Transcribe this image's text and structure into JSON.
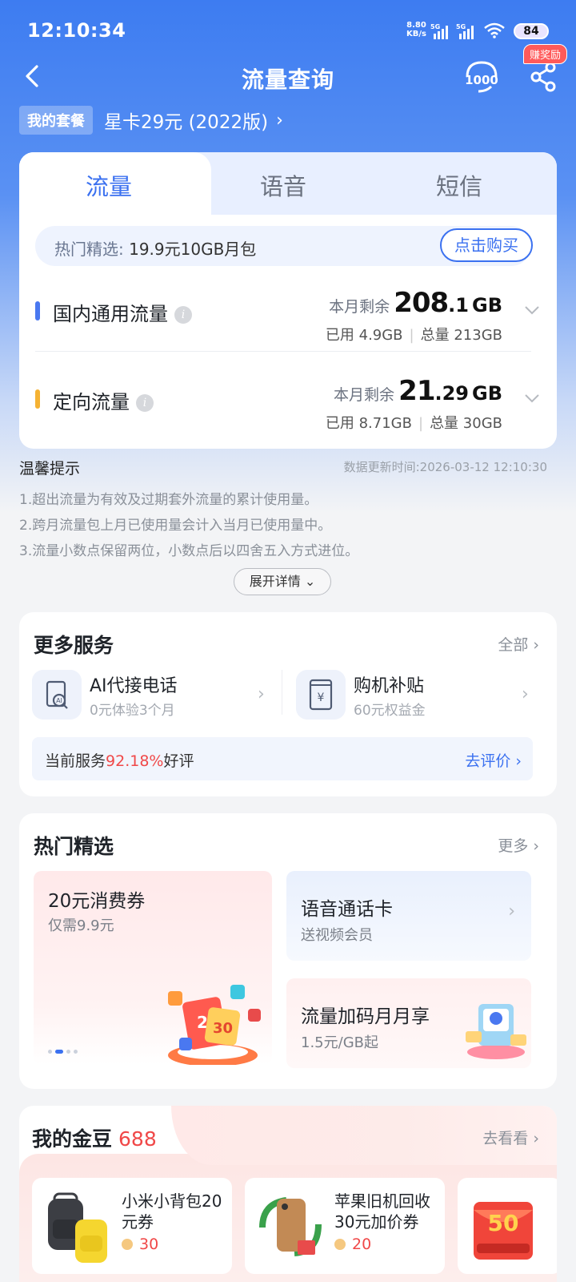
{
  "status": {
    "time": "12:10:34",
    "speed_value": "8.80",
    "speed_unit": "KB/s",
    "sim1": "5G",
    "sim2": "5G",
    "battery": "84"
  },
  "header": {
    "title": "流量查询",
    "service_icon": "service-1000-icon",
    "share_icon": "share-icon",
    "reward_badge": "赚奖励"
  },
  "plan": {
    "tag": "我的套餐",
    "name": "星卡29元 (2022版)"
  },
  "tabs": [
    {
      "label": "流量",
      "active": true
    },
    {
      "label": "语音",
      "active": false
    },
    {
      "label": "短信",
      "active": false
    }
  ],
  "promo": {
    "label": "热门精选: ",
    "text": "19.9元10GB月包",
    "button": "点击购买"
  },
  "usage": [
    {
      "name": "国内通用流量",
      "bar_color": "#4a78f0",
      "remain_label": "本月剩余",
      "remain_int": "208",
      "remain_dec": ".1",
      "unit": "GB",
      "used": "已用 4.9GB",
      "total": "总量 213GB"
    },
    {
      "name": "定向流量",
      "bar_color": "#f5b233",
      "remain_label": "本月剩余",
      "remain_int": "21",
      "remain_dec": ".29",
      "unit": "GB",
      "used": "已用 8.71GB",
      "total": "总量 30GB"
    }
  ],
  "tips": {
    "title": "温馨提示",
    "update_time": "数据更新时间:2026-03-12 12:10:30",
    "items": [
      "1.超出流量为有效及过期套外流量的累计使用量。",
      "2.跨月流量包上月已使用量会计入当月已使用量中。",
      "3.流量小数点保留两位，小数点后以四舍五入方式进位。"
    ],
    "expand": "展开详情"
  },
  "services": {
    "title": "更多服务",
    "more": "全部",
    "items": [
      {
        "name": "AI代接电话",
        "sub": "0元体验3个月",
        "icon": "ai-phone-icon"
      },
      {
        "name": "购机补贴",
        "sub": "60元权益金",
        "icon": "phone-yuan-icon"
      }
    ],
    "rating_prefix": "当前服务",
    "rating_pct": "92.18%",
    "rating_suffix": "好评",
    "rate_action": "去评价"
  },
  "hot": {
    "title": "热门精选",
    "more": "更多",
    "big": {
      "name": "20元消费券",
      "sub": "仅需9.9元"
    },
    "items": [
      {
        "name": "语音通话卡",
        "sub": "送视频会员"
      },
      {
        "name": "流量加码月月享",
        "sub": "1.5元/GB起"
      }
    ]
  },
  "gold": {
    "title": "我的金豆",
    "count": "688",
    "more": "去看看",
    "products": [
      {
        "name": "小米小背包20元券",
        "price": "30"
      },
      {
        "name": "苹果旧机回收30元加价券",
        "price": "20"
      }
    ],
    "third_badge": "50"
  },
  "colors": {
    "accent": "#3b71f0",
    "red": "#f04848",
    "header_bg": "#3d7cf1"
  }
}
